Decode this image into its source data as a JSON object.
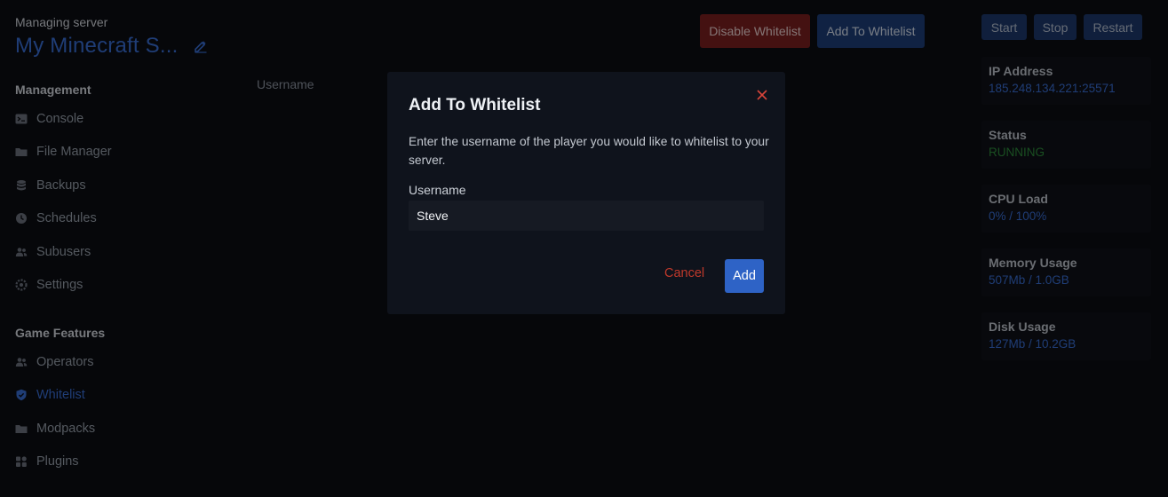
{
  "header": {
    "subtitle": "Managing server",
    "server_name": "My Minecraft S..."
  },
  "sidebar": {
    "management_heading": "Management",
    "management_items": [
      {
        "label": "Console",
        "icon": "console-icon"
      },
      {
        "label": "File Manager",
        "icon": "folder-icon"
      },
      {
        "label": "Backups",
        "icon": "database-icon"
      },
      {
        "label": "Schedules",
        "icon": "clock-icon"
      },
      {
        "label": "Subusers",
        "icon": "users-icon"
      },
      {
        "label": "Settings",
        "icon": "gear-icon"
      }
    ],
    "game_heading": "Game Features",
    "game_items": [
      {
        "label": "Operators",
        "icon": "users-icon"
      },
      {
        "label": "Whitelist",
        "icon": "shield-icon",
        "active": true
      },
      {
        "label": "Modpacks",
        "icon": "folder-icon"
      },
      {
        "label": "Plugins",
        "icon": "puzzle-icon"
      }
    ]
  },
  "main": {
    "column_header": "Username",
    "disable_button": "Disable Whitelist",
    "add_button": "Add To Whitelist"
  },
  "controls": {
    "start": "Start",
    "stop": "Stop",
    "restart": "Restart"
  },
  "stats": [
    {
      "label": "IP Address",
      "value": "185.248.134.221:25571"
    },
    {
      "label": "Status",
      "value": "RUNNING"
    },
    {
      "label": "CPU Load",
      "value": "0% / 100%"
    },
    {
      "label": "Memory Usage",
      "value": "507Mb / 1.0GB"
    },
    {
      "label": "Disk Usage",
      "value": "127Mb / 10.2GB"
    }
  ],
  "modal": {
    "title": "Add To Whitelist",
    "description": "Enter the username of the player you would like to whitelist to your server.",
    "field_label": "Username",
    "username_value": "Steve",
    "cancel": "Cancel",
    "submit": "Add"
  },
  "colors": {
    "accent": "#3a6fd8",
    "danger": "#c0392b",
    "running": "#2f8f3c"
  }
}
